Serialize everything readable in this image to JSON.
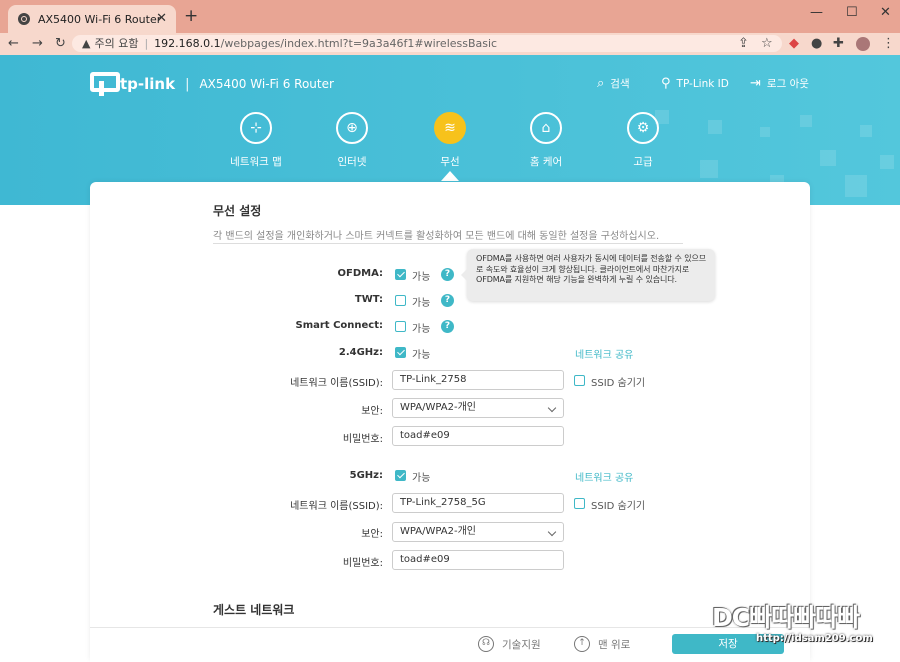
{
  "browser": {
    "tab_title": "AX5400 Wi-Fi 6 Router",
    "tab_close": "✕",
    "new_tab": "+",
    "address": {
      "security_label": "주의 요함",
      "host": "192.168.0.1",
      "path": "/webpages/index.html?t=9a3a46f1#wirelessBasic"
    },
    "icons": [
      "back-icon",
      "forward-icon",
      "reload-icon",
      "warning-icon",
      "share-icon",
      "star-icon",
      "extension-icon",
      "puzzle-icon",
      "profile-avatar"
    ]
  },
  "header": {
    "brand": "tp-link",
    "model": "AX5400 Wi-Fi 6 Router",
    "actions": {
      "search": "검색",
      "tplink_id": "TP-Link ID",
      "logout": "로그 아웃"
    },
    "nav": [
      {
        "label": "네트워크 맵",
        "icon": "network-map-icon"
      },
      {
        "label": "인터넷",
        "icon": "globe-icon"
      },
      {
        "label": "무선",
        "icon": "wifi-icon",
        "active": true
      },
      {
        "label": "홈 케어",
        "icon": "home-care-icon"
      },
      {
        "label": "고급",
        "icon": "gear-icon"
      }
    ],
    "colors": {
      "header": "#3fb8d3",
      "active": "#f7c21b",
      "accent": "#3fb8c7"
    }
  },
  "wireless": {
    "title": "무선 설정",
    "description": "각 밴드의 설정을 개인화하거나 스마트 커넥트를 활성화하여 모든 밴드에 대해 동일한 설정을 구성하십시오.",
    "ofdma": {
      "label": "OFDMA:",
      "option": "가능",
      "checked": true
    },
    "twt": {
      "label": "TWT:",
      "option": "가능",
      "checked": false
    },
    "smart_connect": {
      "label": "Smart Connect:",
      "option": "가능",
      "checked": false
    },
    "tooltip": "OFDMA를 사용하면 여러 사용자가 동시에 데이터를 전송할 수 있으므로 속도와 효율성이 크게 향상됩니다. 클라이언트에서 마찬가지로 OFDMA를 지원하면 해당 기능을 완벽하게 누릴 수 있습니다.",
    "band24": {
      "label": "2.4GHz:",
      "option": "가능",
      "checked": true,
      "share_link": "네트워크 공유",
      "ssid_label": "네트워크 이름(SSID):",
      "ssid": "TP-Link_2758",
      "hide_ssid": "SSID 숨기기",
      "security_label": "보안:",
      "security": "WPA/WPA2-개인",
      "password_label": "비밀번호:",
      "password": "toad#e09"
    },
    "band5": {
      "label": "5GHz:",
      "option": "가능",
      "checked": true,
      "share_link": "네트워크 공유",
      "ssid_label": "네트워크 이름(SSID):",
      "ssid": "TP-Link_2758_5G",
      "hide_ssid": "SSID 숨기기",
      "security_label": "보안:",
      "security": "WPA/WPA2-개인",
      "password_label": "비밀번호:",
      "password": "toad#e09"
    },
    "guest_title": "게스트 네트워크"
  },
  "footer": {
    "support": "기술지원",
    "top": "맨 위로",
    "save": "저장"
  },
  "watermark": {
    "logo": "DC빠따빠따빠",
    "url": "http://idsam209.com"
  }
}
